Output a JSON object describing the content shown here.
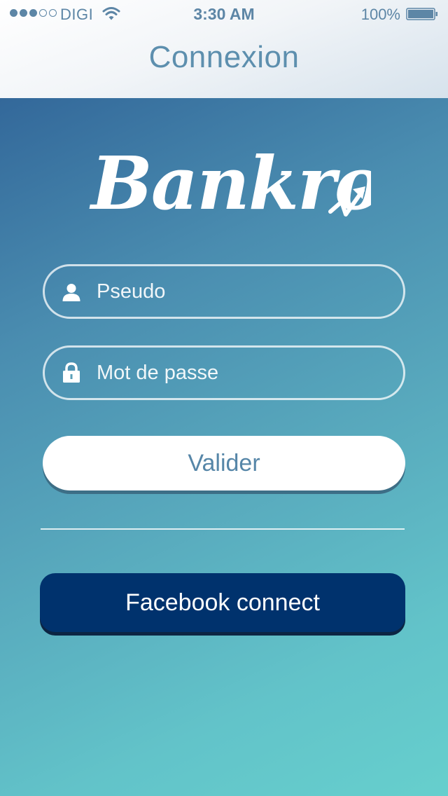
{
  "status_bar": {
    "carrier": "DIGI",
    "time": "3:30 AM",
    "battery_percent": "100%",
    "signal_bars_filled": 3,
    "signal_bars_total": 5
  },
  "header": {
    "title": "Connexion"
  },
  "logo": {
    "text": "Bankroll"
  },
  "form": {
    "username": {
      "placeholder": "Pseudo",
      "value": "",
      "icon": "user-icon"
    },
    "password": {
      "placeholder": "Mot de passe",
      "value": "",
      "icon": "lock-icon"
    },
    "submit_label": "Valider"
  },
  "facebook": {
    "label": "Facebook connect"
  },
  "colors": {
    "header_text": "#5d8fae",
    "gradient_start": "#33689a",
    "gradient_end": "#66cfcd",
    "facebook_button": "#00326d",
    "submit_text": "#5686a8"
  }
}
